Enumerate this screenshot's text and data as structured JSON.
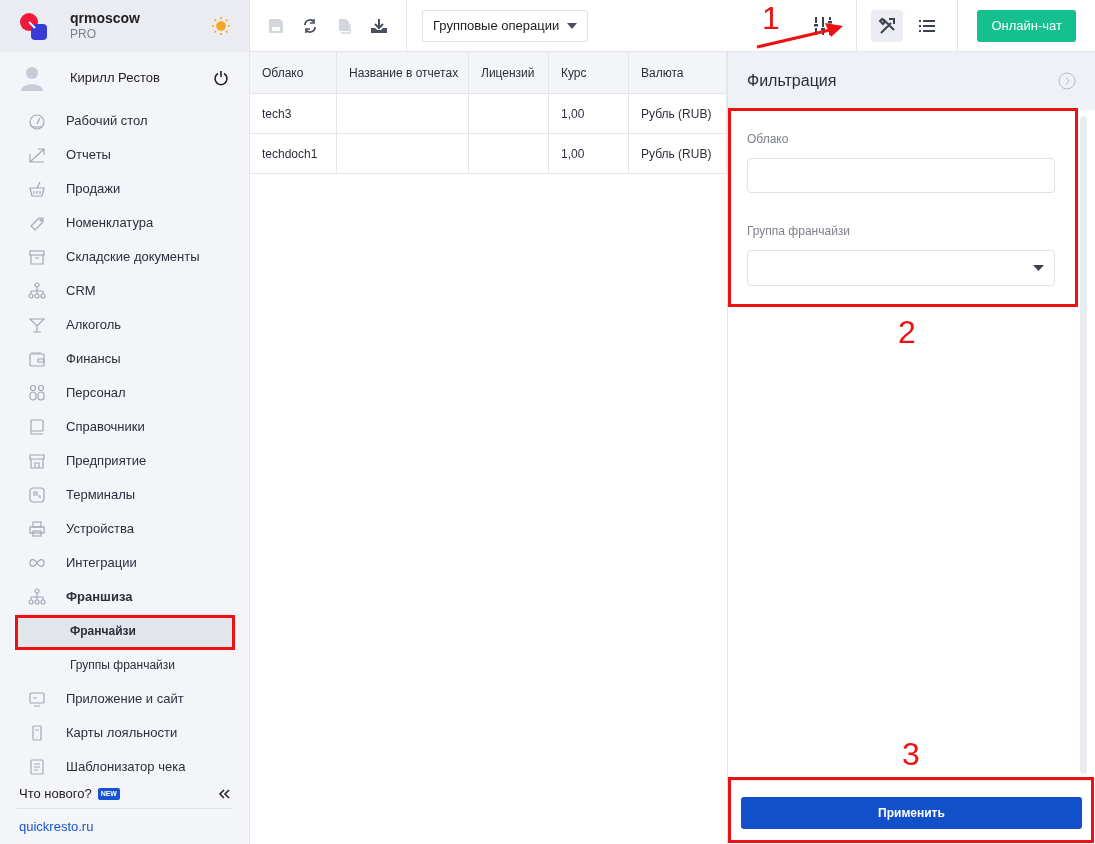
{
  "account": {
    "name": "qrmoscow",
    "plan": "PRO"
  },
  "user": {
    "name": "Кирилл Рестов"
  },
  "nav": [
    {
      "label": "Рабочий стол",
      "expanded": false
    },
    {
      "label": "Отчеты",
      "expanded": false
    },
    {
      "label": "Продажи",
      "expanded": false
    },
    {
      "label": "Номенклатура",
      "expanded": false
    },
    {
      "label": "Складские документы",
      "expanded": false
    },
    {
      "label": "CRM",
      "expanded": false
    },
    {
      "label": "Алкоголь",
      "expanded": false
    },
    {
      "label": "Финансы",
      "expanded": false
    },
    {
      "label": "Персонал",
      "expanded": false
    },
    {
      "label": "Справочники",
      "expanded": false
    },
    {
      "label": "Предприятие",
      "expanded": false
    },
    {
      "label": "Терминалы",
      "expanded": false
    },
    {
      "label": "Устройства",
      "expanded": false
    },
    {
      "label": "Интеграции",
      "expanded": false
    },
    {
      "label": "Франшиза",
      "expanded": true,
      "children": [
        {
          "label": "Франчайзи",
          "selected": true
        },
        {
          "label": "Группы франчайзи",
          "selected": false
        }
      ]
    },
    {
      "label": "Приложение и сайт",
      "expanded": false
    },
    {
      "label": "Карты лояльности",
      "expanded": false
    },
    {
      "label": "Шаблонизатор чека",
      "expanded": false
    }
  ],
  "whats_new": {
    "label": "Что нового?",
    "badge": "NEW"
  },
  "site_link": "quickresto.ru",
  "toolbar": {
    "group_ops": "Групповые операции",
    "chat_button": "Онлайн-чат"
  },
  "table": {
    "columns": [
      "Облако",
      "Название в отчетах",
      "Лицензий",
      "Курс",
      "Валюта"
    ],
    "rows": [
      [
        "tech3",
        "",
        "",
        "1,00",
        "Рубль (RUB)"
      ],
      [
        "techdoch1",
        "",
        "",
        "1,00",
        "Рубль (RUB)"
      ]
    ]
  },
  "filter_panel": {
    "title": "Фильтрация",
    "fields": [
      {
        "label": "Облако",
        "kind": "text"
      },
      {
        "label": "Группа франчайзи",
        "kind": "select"
      }
    ],
    "apply_button": "Применить"
  },
  "annotations": [
    "1",
    "2",
    "3"
  ]
}
